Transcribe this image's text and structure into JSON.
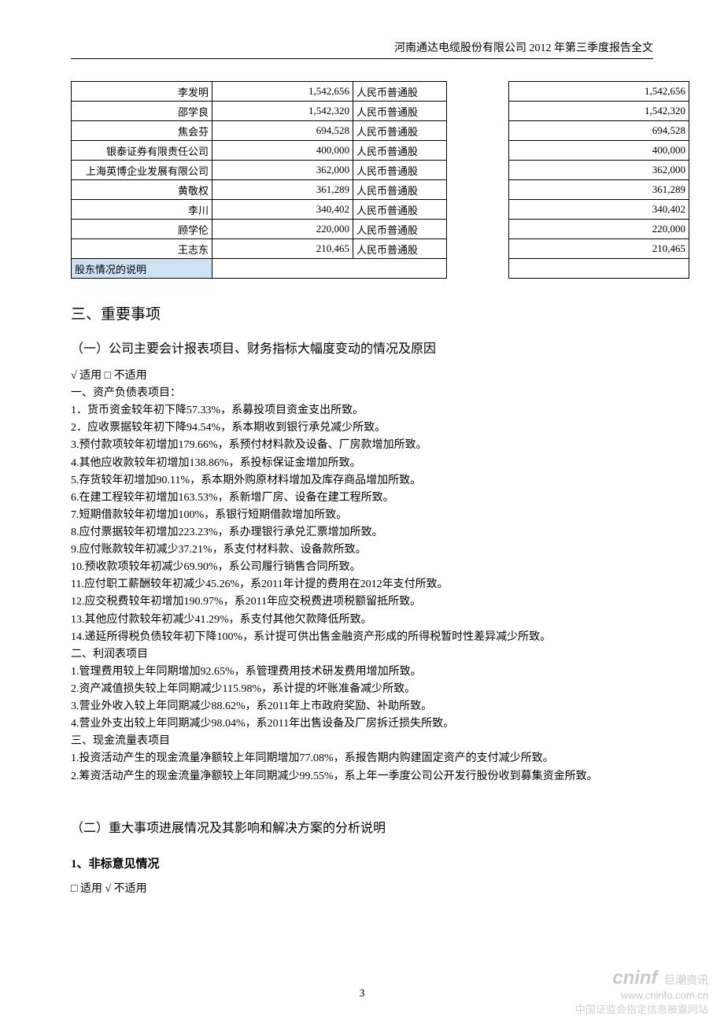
{
  "header": {
    "title": "河南通达电缆股份有限公司 2012 年第三季度报告全文"
  },
  "shareholders": {
    "rows": [
      {
        "name": "李发明",
        "shares": "1,542,656",
        "type": "人民币普通股",
        "right": "1,542,656"
      },
      {
        "name": "邵学良",
        "shares": "1,542,320",
        "type": "人民币普通股",
        "right": "1,542,320"
      },
      {
        "name": "焦会芬",
        "shares": "694,528",
        "type": "人民币普通股",
        "right": "694,528"
      },
      {
        "name": "银泰证券有限责任公司",
        "shares": "400,000",
        "type": "人民币普通股",
        "right": "400,000"
      },
      {
        "name": "上海英博企业发展有限公司",
        "shares": "362,000",
        "type": "人民币普通股",
        "right": "362,000"
      },
      {
        "name": "黄敬权",
        "shares": "361,289",
        "type": "人民币普通股",
        "right": "361,289"
      },
      {
        "name": "李川",
        "shares": "340,402",
        "type": "人民币普通股",
        "right": "340,402"
      },
      {
        "name": "顾学伦",
        "shares": "220,000",
        "type": "人民币普通股",
        "right": "220,000"
      },
      {
        "name": "王志东",
        "shares": "210,465",
        "type": "人民币普通股",
        "right": "210,465"
      }
    ],
    "footer_label": "股东情况的说明"
  },
  "sections": {
    "s3_title": "三、重要事项",
    "s3_1_title": "（一）公司主要会计报表项目、财务指标大幅度变动的情况及原因",
    "applicable1": "√ 适用 □ 不适用",
    "balance_heading": "一、资产负债表项目：",
    "balance_items": [
      "1．货币资金较年初下降57.33%，系募投项目资金支出所致。",
      "2．应收票据较年初下降94.54%，系本期收到银行承兑减少所致。",
      "3.预付款项较年初增加179.66%，系预付材料款及设备、厂房款增加所致。",
      "4.其他应收款较年初增加138.86%，系投标保证金增加所致。",
      "5.存货较年初增加90.11%，系本期外购原材料增加及库存商品增加所致。",
      "6.在建工程较年初增加163.53%，系新增厂房、设备在建工程所致。",
      "7.短期借款较年初增加100%，系银行短期借款增加所致。",
      "8.应付票据较年初增加223.23%，系办理银行承兑汇票增加所致。",
      "9.应付账款较年初减少37.21%，系支付材料款、设备款所致。",
      "10.预收款项较年初减少69.90%，系公司履行销售合同所致。",
      "11.应付职工薪酬较年初减少45.26%，系2011年计提的费用在2012年支付所致。",
      "12.应交税费较年初增加190.97%，系2011年应交税费进项税额留抵所致。",
      "13.其他应付款较年初减少41.29%，系支付其他欠款降低所致。",
      "14.递延所得税负债较年初下降100%，系计提可供出售金融资产形成的所得税暂时性差异减少所致。"
    ],
    "income_heading": "二、利润表项目",
    "income_items": [
      "1.管理费用较上年同期增加92.65%，系管理费用技术研发费用增加所致。",
      "2.资产减值损失较上年同期减少115.98%，系计提的坏账准备减少所致。",
      "3.营业外收入较上年同期减少88.62%，系2011年上市政府奖励、补助所致。",
      "4.营业外支出较上年同期减少98.04%，系2011年出售设备及厂房拆迁损失所致。"
    ],
    "cashflow_heading": "三、现金流量表项目",
    "cashflow_items": [
      "1.投资活动产生的现金流量净额较上年同期增加77.08%，系报告期内购建固定资产的支付减少所致。",
      "2.筹资活动产生的现金流量净额较上年同期减少99.55%，系上年一季度公司公开发行股份收到募集资金所致。"
    ],
    "s3_2_title": "（二）重大事项进展情况及其影响和解决方案的分析说明",
    "s3_2_sub1_title": "1、非标意见情况",
    "applicable2": "□ 适用 √ 不适用"
  },
  "footer": {
    "page_number": "3",
    "watermark_logo": "cninf",
    "watermark_tag": "巨潮资讯",
    "watermark_url": "www.cninfo.com.cn",
    "watermark_note": "中国证监会指定信息披露网站"
  }
}
